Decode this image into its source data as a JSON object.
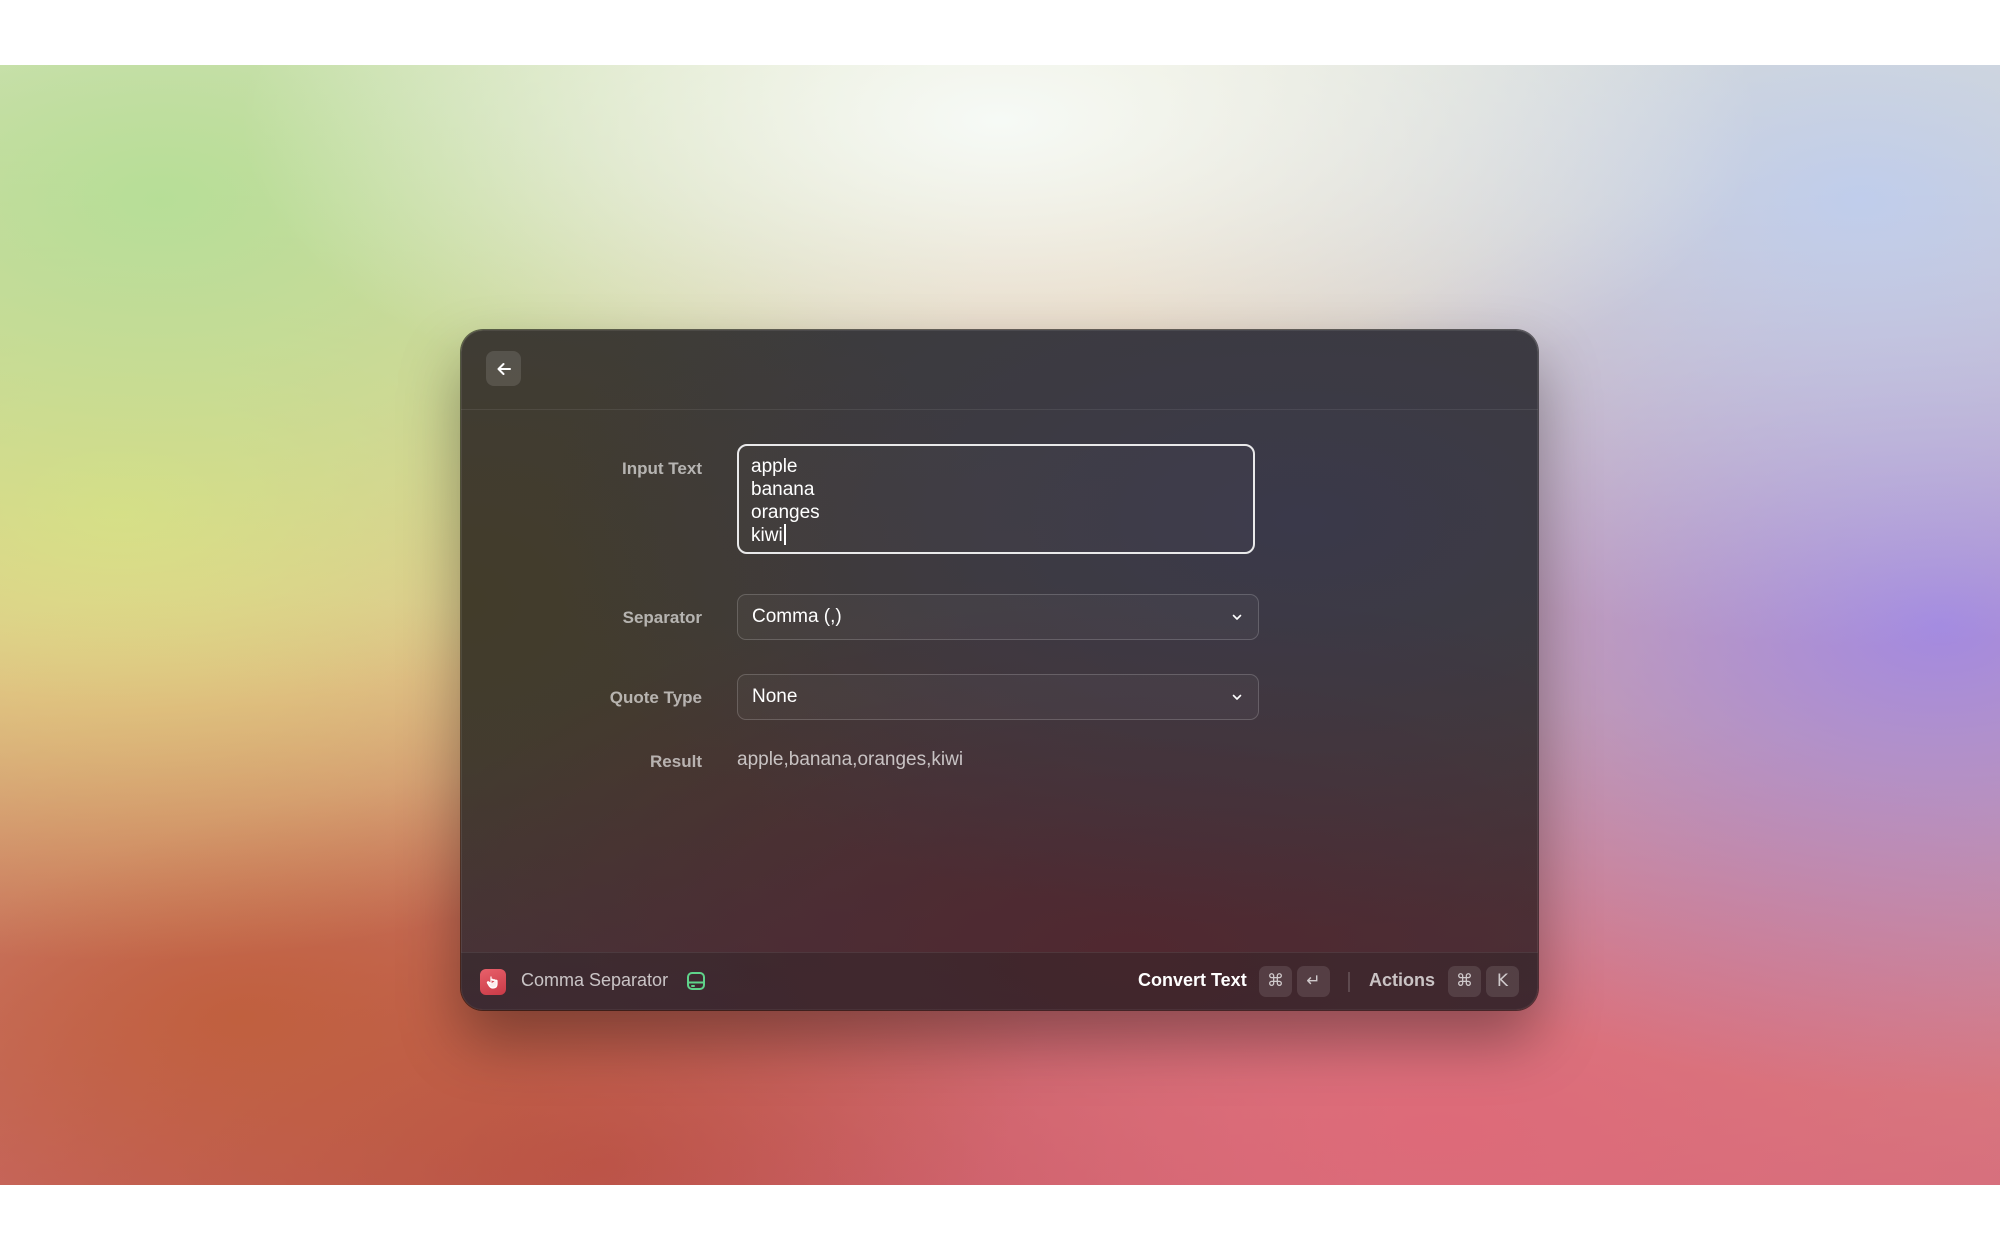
{
  "form": {
    "input_text": {
      "label": "Input Text",
      "lines": [
        "apple",
        "banana",
        "oranges",
        "kiwi"
      ]
    },
    "separator": {
      "label": "Separator",
      "selected": "Comma (,)"
    },
    "quote_type": {
      "label": "Quote Type",
      "selected": "None"
    },
    "result": {
      "label": "Result",
      "value": "apple,banana,oranges,kiwi"
    }
  },
  "footer": {
    "command_name": "Comma Separator",
    "primary_action": "Convert Text",
    "primary_shortcut": [
      "⌘",
      "↵"
    ],
    "actions_label": "Actions",
    "actions_shortcut": [
      "⌘",
      "K"
    ]
  },
  "colors": {
    "accent_icon": "#d94a57",
    "extension_icon": "#5fd38a"
  },
  "icons": {
    "back": "arrow-left-icon",
    "app": "app-icon",
    "extension": "extension-icon",
    "chevron": "chevron-down-icon"
  }
}
